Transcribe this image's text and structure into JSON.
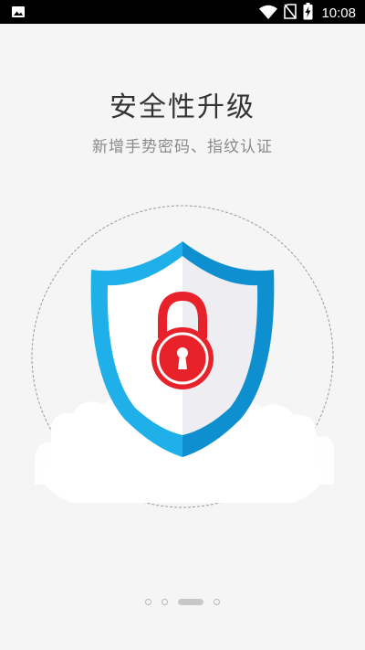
{
  "status_bar": {
    "time": "10:08",
    "icons": [
      "image-icon",
      "wifi-icon",
      "no-sim-icon",
      "battery-charging-icon"
    ]
  },
  "onboarding": {
    "title": "安全性升级",
    "subtitle": "新增手势密码、指纹认证"
  },
  "illustration": {
    "icons": [
      "shield-icon",
      "padlock-icon",
      "cloud-icon"
    ],
    "colors": {
      "shield_outer_light": "#1fb0ea",
      "shield_outer_dark": "#0e8fd0",
      "shield_inner_light": "#ffffff",
      "shield_inner_dark": "#eeedf1",
      "lock": "#e8222a",
      "lock_dark": "#c8181f"
    }
  },
  "pager": {
    "page_count": 4,
    "current_page": 3
  }
}
